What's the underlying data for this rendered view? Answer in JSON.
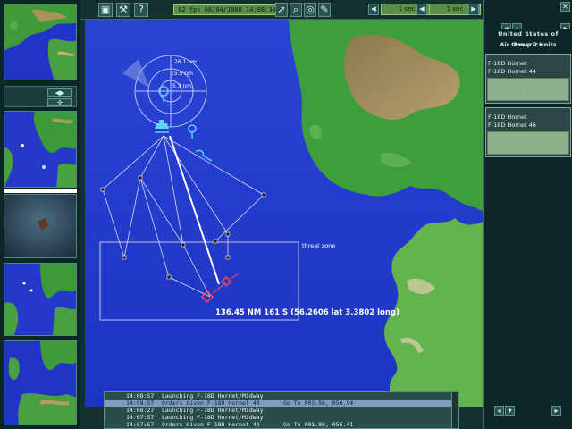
{
  "toolbar": {
    "status": "62 fps 08/04/1988 14:08:34",
    "time_left": "1 sec",
    "time_right": "1 sec",
    "icons": [
      "cube-icon",
      "tools-icon",
      "help-icon",
      "pointer-icon",
      "search-icon",
      "target-icon",
      "pencil-icon"
    ]
  },
  "map": {
    "rings": [
      "26.1 nm",
      "15.5 nm",
      "5.3 nm"
    ],
    "zone_label": "threat zone",
    "readout": "136.45  NM  161  S  (56.2606  lat  3.3802  long)"
  },
  "right_panel": {
    "country": "United States of America",
    "group": "Air Group 2 Units",
    "units": [
      {
        "line1": "F-18D Hornet",
        "line2": "F-18D Hornet 44",
        "status": "."
      },
      {
        "line1": "F-18D Hornet",
        "line2": "F-18D Hornet 46",
        "status": "."
      }
    ]
  },
  "log": [
    {
      "time": "14:08:57",
      "msg": "Launching F-18D Hornet/Midway",
      "coord": ""
    },
    {
      "time": "14:08:57",
      "msg": "Orders Given F-18D Hornet 44",
      "coord": "Go To 003.56, 056.94"
    },
    {
      "time": "14:08:27",
      "msg": "Launching F-18D Hornet/Midway",
      "coord": ""
    },
    {
      "time": "14:07:57",
      "msg": "Launching F-18D Hornet/Midway",
      "coord": ""
    },
    {
      "time": "14:07:57",
      "msg": "Orders Given F-18D Hornet 40",
      "coord": "Go To 001.86, 056.41"
    }
  ]
}
